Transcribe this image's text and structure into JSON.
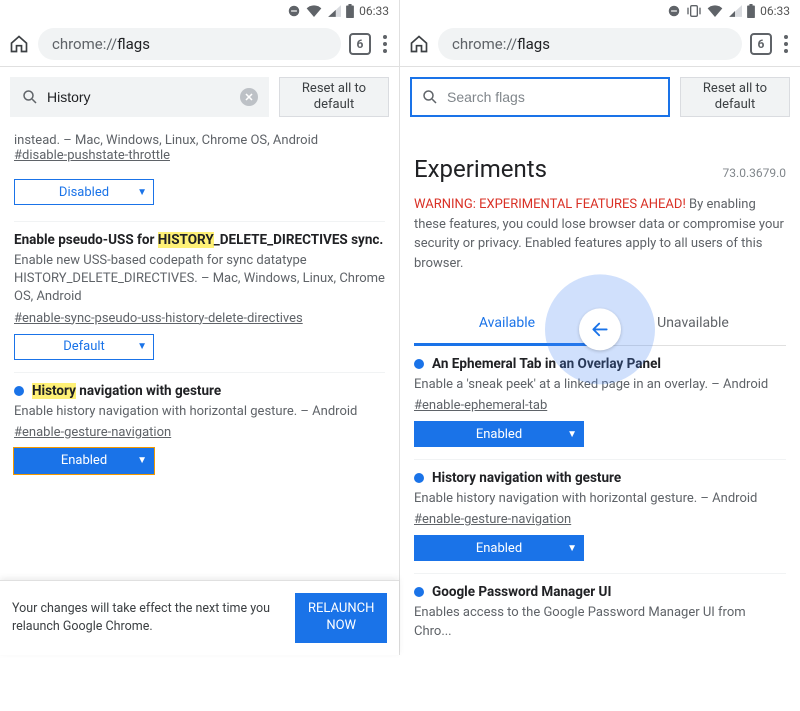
{
  "status": {
    "time": "06:33"
  },
  "toolbar": {
    "url_scheme": "chrome://",
    "url_path": "flags",
    "tab_count": "6"
  },
  "buttons": {
    "reset_line1": "Reset all to",
    "reset_line2": "default",
    "relaunch": "RELAUNCH NOW"
  },
  "left": {
    "search_value": "History",
    "truncated_top": "instead. – Mac, Windows, Linux, Chrome OS, Android",
    "truncated_link": "#disable-pushstate-throttle",
    "relaunch_text": "Your changes will take effect the next time you relaunch Google Chrome.",
    "flags": [
      {
        "dropdown_value": "Disabled",
        "dropdown_style": "default"
      },
      {
        "title_pre": "Enable pseudo-USS for ",
        "title_hl": "HISTORY",
        "title_post": "_DELETE_DIRECTIVES sync.",
        "desc": "Enable new USS-based codepath for sync datatype HISTORY_DELETE_DIRECTIVES. – Mac, Windows, Linux, Chrome OS, Android",
        "link": "#enable-sync-pseudo-uss-history-delete-directives",
        "dropdown_value": "Default",
        "dropdown_style": "default"
      },
      {
        "dot": true,
        "title_hl": "History",
        "title_post": " navigation with gesture",
        "desc": "Enable history navigation with horizontal gesture. – Android",
        "link": "#enable-gesture-navigation",
        "dropdown_value": "Enabled",
        "dropdown_style": "enabled-orange"
      }
    ]
  },
  "right": {
    "search_placeholder": "Search flags",
    "experiments_title": "Experiments",
    "version": "73.0.3679.0",
    "warning_red": "WARNING: EXPERIMENTAL FEATURES AHEAD!",
    "warning_rest": " By enabling these features, you could lose browser data or compromise your security or privacy. Enabled features apply to all users of this browser.",
    "tab_available": "Available",
    "tab_unavailable": "Unavailable",
    "flags": [
      {
        "title": "An Ephemeral Tab in an Overlay Panel",
        "desc": "Enable a 'sneak peek' at a linked page in an overlay. – Android",
        "link": "#enable-ephemeral-tab",
        "dropdown_value": "Enabled"
      },
      {
        "title": "History navigation with gesture",
        "desc": "Enable history navigation with horizontal gesture. – Android",
        "link": "#enable-gesture-navigation",
        "dropdown_value": "Enabled"
      },
      {
        "title": "Google Password Manager UI",
        "desc": "Enables access to the Google Password Manager UI from Chro..."
      }
    ]
  }
}
